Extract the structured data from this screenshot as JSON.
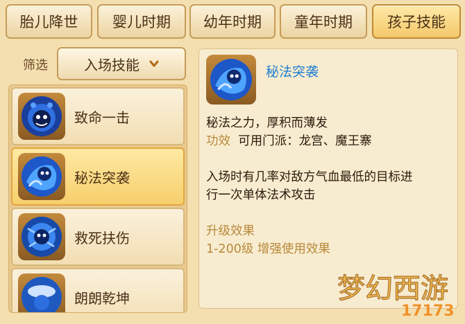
{
  "tabs": [
    {
      "label": "胎儿降世",
      "active": false
    },
    {
      "label": "婴儿时期",
      "active": false
    },
    {
      "label": "幼年时期",
      "active": false
    },
    {
      "label": "童年时期",
      "active": false
    },
    {
      "label": "孩子技能",
      "active": true
    }
  ],
  "filter": {
    "label": "筛选",
    "selected": "入场技能"
  },
  "skills": [
    {
      "name": "致命一击",
      "icon": "dark-spirit-icon",
      "selected": false
    },
    {
      "name": "秘法突袭",
      "icon": "blue-spirit-icon",
      "selected": true
    },
    {
      "name": "救死扶伤",
      "icon": "healing-spirit-icon",
      "selected": false
    },
    {
      "name": "朗朗乾坤",
      "icon": "cloud-spirit-icon",
      "selected": false
    }
  ],
  "detail": {
    "title": "秘法突袭",
    "line1": "秘法之力，厚积而薄发",
    "effect_label": "功效",
    "sect_text": "可用门派：龙宫、魔王寨",
    "desc_line1": "入场时有几率对敌方气血最低的目标进",
    "desc_line2": "行一次单体法术攻击",
    "upgrade_label": "升级效果",
    "upgrade_text": "1-200级 增强使用效果"
  },
  "watermark": {
    "logo_text": "梦幻西游",
    "site": "17173"
  },
  "colors": {
    "accent": "#b7893b",
    "skill_title": "#1f7fd1",
    "selected_bg": "#f7cf6d"
  }
}
